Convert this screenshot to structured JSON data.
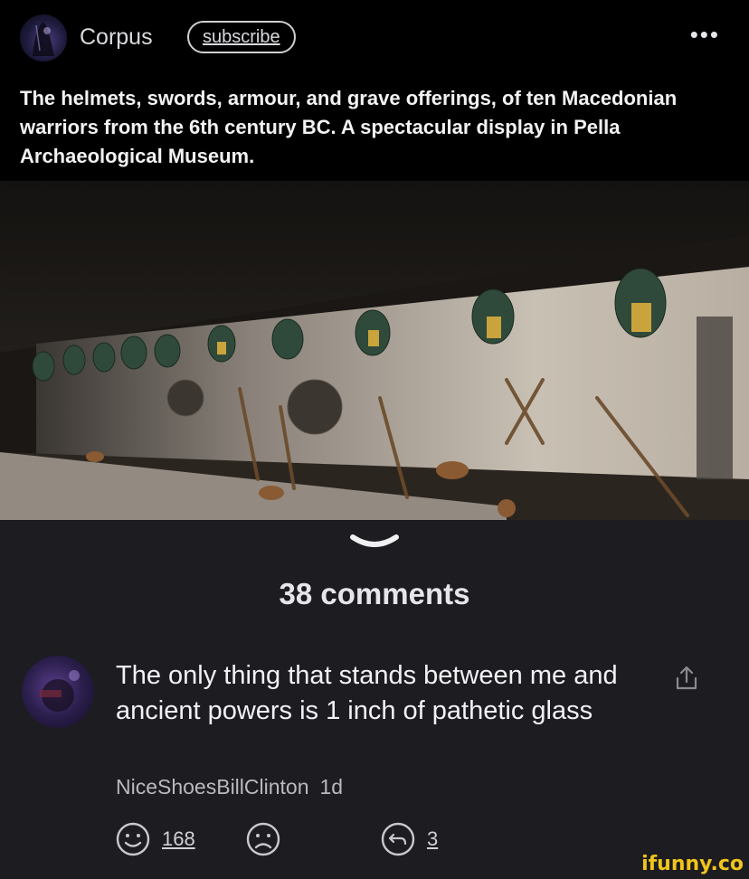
{
  "header": {
    "channel_name": "Corpus",
    "subscribe_label": "subscribe",
    "more_label": "•••"
  },
  "post": {
    "title": "The helmets, swords, armour, and grave offerings, of ten Macedonian warriors from the 6th century BC. A spectacular display in Pella Archaeological Museum."
  },
  "comments_section": {
    "count_label": "38 comments"
  },
  "comment": {
    "text": "The only thing that stands between me and ancient powers is 1 inch of pathetic glass",
    "author": "NiceShoesBillClinton",
    "time": "1d",
    "likes": "168",
    "replies": "3"
  },
  "watermark": "ifunny.co",
  "colors": {
    "background": "#1c1c21",
    "header_bg": "#000000",
    "text": "#e8e8ea",
    "watermark": "#f0c41b"
  },
  "icons": [
    "more-icon",
    "chevron-down-icon",
    "share-icon",
    "smile-icon",
    "frown-icon",
    "reply-icon"
  ]
}
